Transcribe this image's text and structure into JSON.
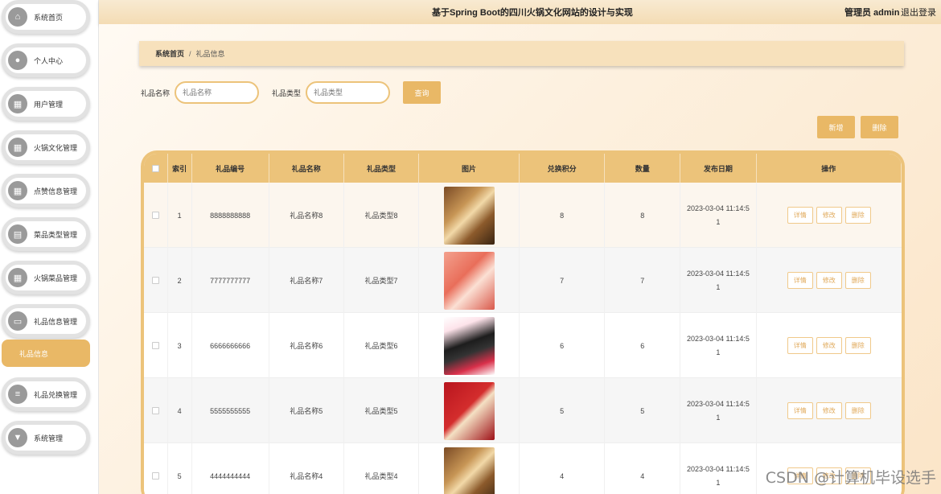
{
  "header": {
    "title": "基于Spring Boot的四川火锅文化网站的设计与实现",
    "user": "管理员 admin",
    "logout": "退出登录"
  },
  "sidebar": {
    "items": [
      {
        "label": "系统首页",
        "icon": "home-icon",
        "glyph": "⌂"
      },
      {
        "label": "个人中心",
        "icon": "person-icon",
        "glyph": "●"
      },
      {
        "label": "用户管理",
        "icon": "grid-icon",
        "glyph": "▦"
      },
      {
        "label": "火锅文化管理",
        "icon": "grid-icon",
        "glyph": "▦"
      },
      {
        "label": "点赞信息管理",
        "icon": "grid-icon",
        "glyph": "▦"
      },
      {
        "label": "菜品类型管理",
        "icon": "document-icon",
        "glyph": "▤"
      },
      {
        "label": "火锅菜品管理",
        "icon": "grid-icon",
        "glyph": "▦"
      },
      {
        "label": "礼品信息管理",
        "icon": "gift-icon",
        "glyph": "▭"
      },
      {
        "label": "礼品兑换管理",
        "icon": "list-icon",
        "glyph": "≡"
      },
      {
        "label": "系统管理",
        "icon": "shield-icon",
        "glyph": "▼"
      }
    ],
    "sub_item": "礼品信息"
  },
  "breadcrumb": {
    "home": "系统首页",
    "sep": "/",
    "current": "礼品信息"
  },
  "search": {
    "name_label": "礼品名称",
    "name_placeholder": "礼品名称",
    "type_label": "礼品类型",
    "type_placeholder": "礼品类型",
    "query_button": "查询"
  },
  "actions": {
    "add": "新增",
    "delete": "删除"
  },
  "table": {
    "headers": [
      "索引",
      "礼品编号",
      "礼品名称",
      "礼品类型",
      "图片",
      "兑换积分",
      "数量",
      "发布日期",
      "操作"
    ],
    "row_ops": [
      "详情",
      "修改",
      "删除"
    ],
    "rows": [
      {
        "index": "1",
        "code": "8888888888",
        "name": "礼品名称8",
        "type": "礼品类型8",
        "points": "8",
        "qty": "8",
        "date_a": "2023-03-04 11:14:5",
        "date_b": "1",
        "img": "a"
      },
      {
        "index": "2",
        "code": "7777777777",
        "name": "礼品名称7",
        "type": "礼品类型7",
        "points": "7",
        "qty": "7",
        "date_a": "2023-03-04 11:14:5",
        "date_b": "1",
        "img": "b"
      },
      {
        "index": "3",
        "code": "6666666666",
        "name": "礼品名称6",
        "type": "礼品类型6",
        "points": "6",
        "qty": "6",
        "date_a": "2023-03-04 11:14:5",
        "date_b": "1",
        "img": "c"
      },
      {
        "index": "4",
        "code": "5555555555",
        "name": "礼品名称5",
        "type": "礼品类型5",
        "points": "5",
        "qty": "5",
        "date_a": "2023-03-04 11:14:5",
        "date_b": "1",
        "img": "d"
      },
      {
        "index": "5",
        "code": "4444444444",
        "name": "礼品名称4",
        "type": "礼品类型4",
        "points": "4",
        "qty": "4",
        "date_a": "2023-03-04 11:14:5",
        "date_b": "1",
        "img": "a"
      }
    ]
  },
  "watermark": "CSDN @计算机毕设选手",
  "colors": {
    "accent": "#e9b866",
    "header_bg": "#f4dcb4",
    "table_head": "#ecc37a"
  }
}
